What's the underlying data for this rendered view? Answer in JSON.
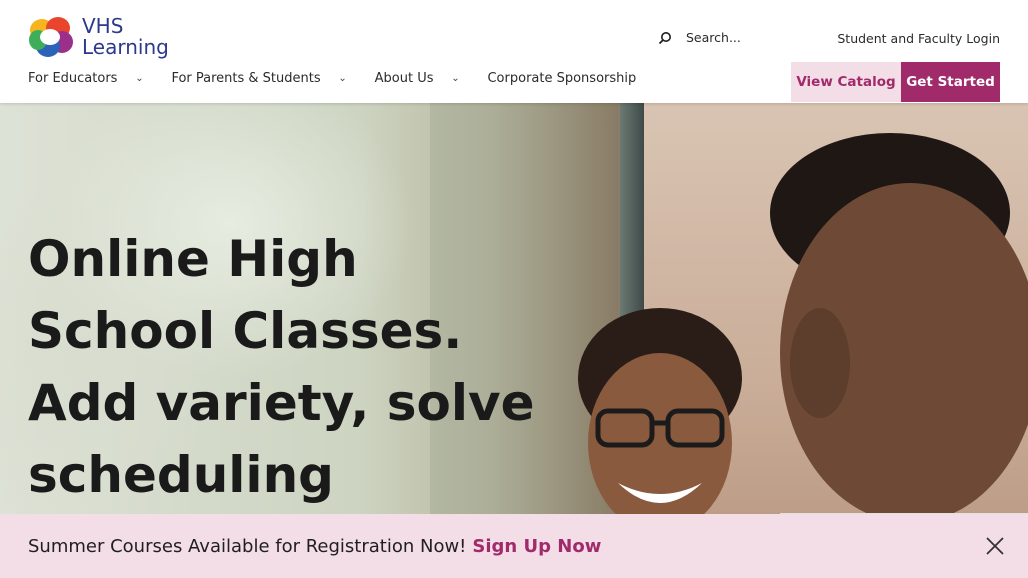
{
  "header": {
    "logo": {
      "line1": "VHS",
      "line2": "Learning"
    },
    "search": {
      "placeholder": "Search..."
    },
    "login_label": "Student and Faculty Login",
    "nav": [
      {
        "label": "For Educators",
        "has_dropdown": true
      },
      {
        "label": "For Parents & Students",
        "has_dropdown": true
      },
      {
        "label": "About Us",
        "has_dropdown": true
      },
      {
        "label": "Corporate Sponsorship",
        "has_dropdown": false
      }
    ],
    "view_catalog_label": "View Catalog",
    "get_started_label": "Get Started"
  },
  "hero": {
    "title": "Online High School Classes. Add variety, solve scheduling"
  },
  "banner": {
    "text": "Summer Courses Available for Registration Now!",
    "link_label": "Sign Up Now"
  },
  "colors": {
    "brand_magenta": "#a12a6a",
    "brand_pink_light": "#f3dde6",
    "logo_blue": "#2d3a8c"
  },
  "icons": {
    "search": "search-icon",
    "chevron": "chevron-down-icon",
    "close": "close-icon"
  }
}
